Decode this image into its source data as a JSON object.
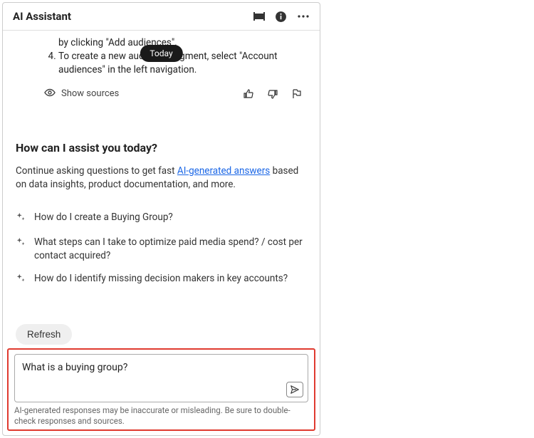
{
  "header": {
    "title": "AI Assistant"
  },
  "today_label": "Today",
  "steps": {
    "start": 4,
    "partial_prev": "by clicking \"Add audiences\".",
    "items": [
      "To create a new audience segment, select \"Account audiences\" in the left navigation."
    ]
  },
  "sources": {
    "show_label": "Show sources"
  },
  "assist": {
    "title": "How can I assist you today?",
    "desc_pre": "Continue asking questions to get fast ",
    "desc_link": "AI-generated answers",
    "desc_post": " based on data insights, product documentation, and more."
  },
  "suggestions": [
    "How do I create a Buying Group?",
    "What steps can I take to optimize paid media spend? / cost per contact acquired?",
    "How do I identify missing decision makers in key accounts?"
  ],
  "refresh_label": "Refresh",
  "input": {
    "value": "What is a buying group?"
  },
  "disclaimer": "AI-generated responses may be inaccurate or misleading. Be sure to double-check responses and sources."
}
